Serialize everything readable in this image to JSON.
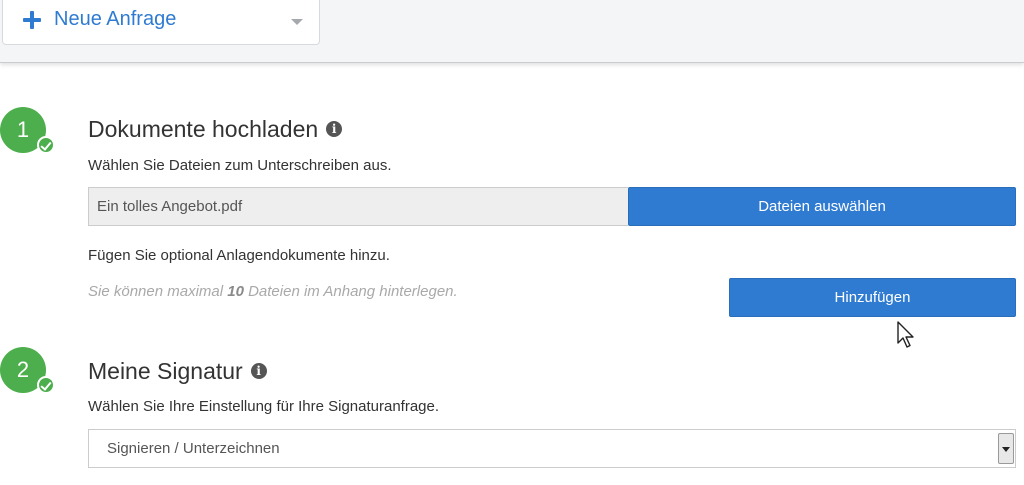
{
  "header": {
    "new_request_label": "Neue Anfrage",
    "icons": [
      "plus-icon",
      "chevron-down-icon"
    ]
  },
  "steps": [
    {
      "number": "1",
      "title": "Dokumente hochladen",
      "subtitle": "Wählen Sie Dateien zum Unterschreiben aus.",
      "file_value": "Ein tolles Angebot.pdf",
      "choose_files_label": "Dateien auswählen",
      "attachments_text": "Fügen Sie optional Anlagendokumente hinzu.",
      "hint_prefix": "Sie können maximal ",
      "hint_count": "10",
      "hint_suffix": " Dateien im Anhang hinterlegen.",
      "add_label": "Hinzufügen"
    },
    {
      "number": "2",
      "title": "Meine Signatur",
      "subtitle": "Wählen Sie Ihre Einstellung für Ihre Signaturanfrage.",
      "select_value": "Signieren / Unterzeichnen"
    }
  ],
  "colors": {
    "accent": "#2f7bd1",
    "step_green": "#4cae4c"
  }
}
